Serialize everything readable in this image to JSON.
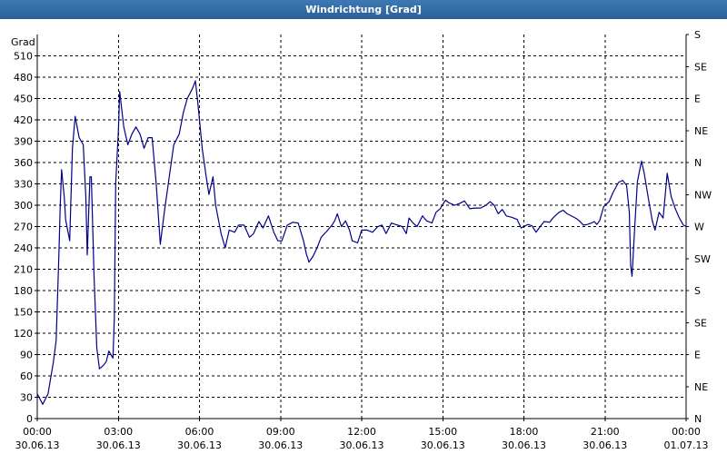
{
  "window": {
    "title": "Windrichtung [Grad]"
  },
  "colors": {
    "titlebar": "#2e64a0",
    "line": "#00008b",
    "grid": "#000000"
  },
  "chart_data": {
    "type": "line",
    "title": "Windrichtung [Grad]",
    "ylabel": "Grad",
    "xlabel": "",
    "ylim": [
      0,
      540
    ],
    "xlim": [
      0,
      24
    ],
    "grid": true,
    "legend": "none",
    "x_axis_unit": "hours since 30.06.13 00:00",
    "y_ticks": [
      0,
      30,
      60,
      90,
      120,
      150,
      180,
      210,
      240,
      270,
      300,
      330,
      360,
      390,
      420,
      450,
      480,
      510
    ],
    "right_ticks": [
      {
        "value": 0,
        "label": "N"
      },
      {
        "value": 45,
        "label": "NE"
      },
      {
        "value": 90,
        "label": "E"
      },
      {
        "value": 135,
        "label": "SE"
      },
      {
        "value": 180,
        "label": "S"
      },
      {
        "value": 225,
        "label": "SW"
      },
      {
        "value": 270,
        "label": "W"
      },
      {
        "value": 315,
        "label": "NW"
      },
      {
        "value": 360,
        "label": "N"
      },
      {
        "value": 405,
        "label": "NE"
      },
      {
        "value": 450,
        "label": "E"
      },
      {
        "value": 495,
        "label": "SE"
      },
      {
        "value": 540,
        "label": "S"
      }
    ],
    "x_ticks": [
      {
        "value": 0,
        "time": "00:00",
        "date": "30.06.13"
      },
      {
        "value": 3,
        "time": "03:00",
        "date": "30.06.13"
      },
      {
        "value": 6,
        "time": "06:00",
        "date": "30.06.13"
      },
      {
        "value": 9,
        "time": "09:00",
        "date": "30.06.13"
      },
      {
        "value": 12,
        "time": "12:00",
        "date": "30.06.13"
      },
      {
        "value": 15,
        "time": "15:00",
        "date": "30.06.13"
      },
      {
        "value": 18,
        "time": "18:00",
        "date": "30.06.13"
      },
      {
        "value": 21,
        "time": "21:00",
        "date": "30.06.13"
      },
      {
        "value": 24,
        "time": "00:00",
        "date": "01.07.13"
      }
    ],
    "series": [
      {
        "values": [
          [
            0.0,
            35
          ],
          [
            0.2,
            20
          ],
          [
            0.4,
            35
          ],
          [
            0.6,
            80
          ],
          [
            0.7,
            110
          ],
          [
            0.8,
            230
          ],
          [
            0.85,
            300
          ],
          [
            0.9,
            350
          ],
          [
            1.0,
            310
          ],
          [
            1.05,
            280
          ],
          [
            1.15,
            260
          ],
          [
            1.2,
            250
          ],
          [
            1.3,
            380
          ],
          [
            1.4,
            425
          ],
          [
            1.55,
            395
          ],
          [
            1.7,
            385
          ],
          [
            1.8,
            310
          ],
          [
            1.85,
            230
          ],
          [
            1.95,
            340
          ],
          [
            2.0,
            340
          ],
          [
            2.1,
            200
          ],
          [
            2.2,
            100
          ],
          [
            2.3,
            70
          ],
          [
            2.45,
            75
          ],
          [
            2.55,
            80
          ],
          [
            2.65,
            95
          ],
          [
            2.8,
            85
          ],
          [
            2.85,
            140
          ],
          [
            2.9,
            330
          ],
          [
            3.0,
            405
          ],
          [
            3.05,
            460
          ],
          [
            3.2,
            410
          ],
          [
            3.35,
            385
          ],
          [
            3.5,
            400
          ],
          [
            3.65,
            410
          ],
          [
            3.8,
            400
          ],
          [
            3.95,
            380
          ],
          [
            4.1,
            395
          ],
          [
            4.25,
            395
          ],
          [
            4.4,
            330
          ],
          [
            4.55,
            245
          ],
          [
            4.7,
            290
          ],
          [
            4.9,
            345
          ],
          [
            5.05,
            385
          ],
          [
            5.25,
            400
          ],
          [
            5.4,
            430
          ],
          [
            5.55,
            450
          ],
          [
            5.75,
            465
          ],
          [
            5.85,
            475
          ],
          [
            5.95,
            440
          ],
          [
            6.1,
            380
          ],
          [
            6.25,
            340
          ],
          [
            6.35,
            315
          ],
          [
            6.5,
            340
          ],
          [
            6.6,
            300
          ],
          [
            6.8,
            260
          ],
          [
            6.95,
            240
          ],
          [
            7.1,
            265
          ],
          [
            7.3,
            262
          ],
          [
            7.45,
            272
          ],
          [
            7.65,
            272
          ],
          [
            7.85,
            255
          ],
          [
            8.0,
            260
          ],
          [
            8.2,
            277
          ],
          [
            8.35,
            268
          ],
          [
            8.55,
            285
          ],
          [
            8.75,
            262
          ],
          [
            8.9,
            250
          ],
          [
            9.05,
            250
          ],
          [
            9.25,
            272
          ],
          [
            9.45,
            276
          ],
          [
            9.65,
            275
          ],
          [
            9.85,
            250
          ],
          [
            9.95,
            232
          ],
          [
            10.05,
            220
          ],
          [
            10.2,
            228
          ],
          [
            10.35,
            240
          ],
          [
            10.5,
            255
          ],
          [
            10.7,
            263
          ],
          [
            10.9,
            272
          ],
          [
            11.0,
            278
          ],
          [
            11.1,
            288
          ],
          [
            11.25,
            270
          ],
          [
            11.4,
            278
          ],
          [
            11.55,
            265
          ],
          [
            11.65,
            250
          ],
          [
            11.85,
            247
          ],
          [
            12.0,
            265
          ],
          [
            12.2,
            265
          ],
          [
            12.4,
            262
          ],
          [
            12.6,
            270
          ],
          [
            12.75,
            272
          ],
          [
            12.9,
            260
          ],
          [
            13.1,
            275
          ],
          [
            13.25,
            273
          ],
          [
            13.5,
            270
          ],
          [
            13.65,
            260
          ],
          [
            13.75,
            282
          ],
          [
            13.9,
            275
          ],
          [
            14.05,
            270
          ],
          [
            14.25,
            285
          ],
          [
            14.4,
            278
          ],
          [
            14.6,
            275
          ],
          [
            14.75,
            290
          ],
          [
            14.9,
            295
          ],
          [
            15.1,
            307
          ],
          [
            15.25,
            303
          ],
          [
            15.45,
            300
          ],
          [
            15.65,
            303
          ],
          [
            15.8,
            306
          ],
          [
            16.0,
            295
          ],
          [
            16.2,
            296
          ],
          [
            16.4,
            296
          ],
          [
            16.6,
            300
          ],
          [
            16.75,
            305
          ],
          [
            16.9,
            300
          ],
          [
            17.05,
            288
          ],
          [
            17.2,
            294
          ],
          [
            17.35,
            285
          ],
          [
            17.55,
            283
          ],
          [
            17.75,
            280
          ],
          [
            17.9,
            268
          ],
          [
            18.0,
            270
          ],
          [
            18.15,
            273
          ],
          [
            18.3,
            271
          ],
          [
            18.45,
            262
          ],
          [
            18.6,
            270
          ],
          [
            18.75,
            277
          ],
          [
            18.95,
            276
          ],
          [
            19.1,
            283
          ],
          [
            19.3,
            290
          ],
          [
            19.45,
            293
          ],
          [
            19.6,
            288
          ],
          [
            19.8,
            284
          ],
          [
            19.95,
            281
          ],
          [
            20.05,
            278
          ],
          [
            20.2,
            272
          ],
          [
            20.35,
            273
          ],
          [
            20.5,
            275
          ],
          [
            20.6,
            277
          ],
          [
            20.7,
            273
          ],
          [
            20.8,
            278
          ],
          [
            20.95,
            298
          ],
          [
            21.15,
            305
          ],
          [
            21.3,
            318
          ],
          [
            21.5,
            332
          ],
          [
            21.65,
            335
          ],
          [
            21.8,
            328
          ],
          [
            21.9,
            290
          ],
          [
            21.95,
            215
          ],
          [
            22.0,
            200
          ],
          [
            22.1,
            270
          ],
          [
            22.2,
            333
          ],
          [
            22.35,
            362
          ],
          [
            22.45,
            345
          ],
          [
            22.6,
            310
          ],
          [
            22.75,
            278
          ],
          [
            22.85,
            265
          ],
          [
            23.0,
            290
          ],
          [
            23.15,
            282
          ],
          [
            23.3,
            345
          ],
          [
            23.45,
            312
          ],
          [
            23.6,
            295
          ],
          [
            23.75,
            282
          ],
          [
            23.9,
            272
          ],
          [
            24.0,
            270
          ],
          [
            24.15,
            273
          ],
          [
            24.3,
            265
          ]
        ]
      }
    ]
  }
}
